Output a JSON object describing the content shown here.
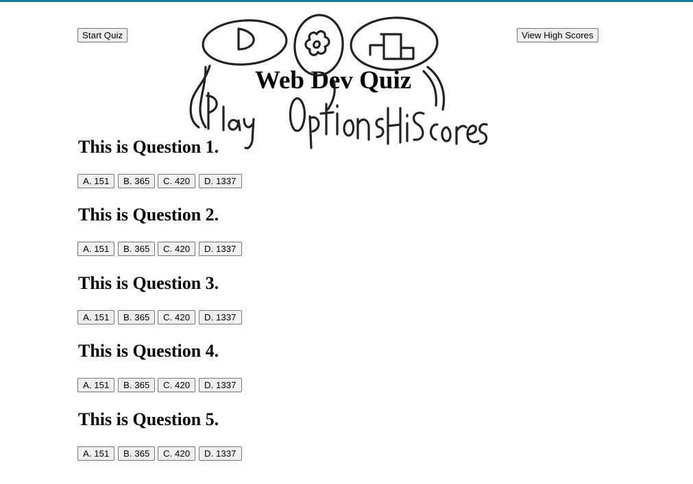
{
  "colors": {
    "top_rule": "#1a7f9a",
    "scribble": "#222222"
  },
  "toolbar": {
    "start_label": "Start Quiz",
    "scores_label": "View High Scores"
  },
  "page": {
    "title": "Web Dev Quiz"
  },
  "sketch": {
    "annotation_words": [
      "Play",
      "Options",
      "HiScores"
    ],
    "icons": [
      "play-icon",
      "options-gear-icon",
      "hiscores-icon"
    ]
  },
  "questions": [
    {
      "text": "This is Question 1.",
      "answers": [
        "A. 151",
        "B. 365",
        "C. 420",
        "D. 1337"
      ]
    },
    {
      "text": "This is Question 2.",
      "answers": [
        "A. 151",
        "B. 365",
        "C. 420",
        "D. 1337"
      ]
    },
    {
      "text": "This is Question 3.",
      "answers": [
        "A. 151",
        "B. 365",
        "C. 420",
        "D. 1337"
      ]
    },
    {
      "text": "This is Question 4.",
      "answers": [
        "A. 151",
        "B. 365",
        "C. 420",
        "D. 1337"
      ]
    },
    {
      "text": "This is Question 5.",
      "answers": [
        "A. 151",
        "B. 365",
        "C. 420",
        "D. 1337"
      ]
    }
  ]
}
